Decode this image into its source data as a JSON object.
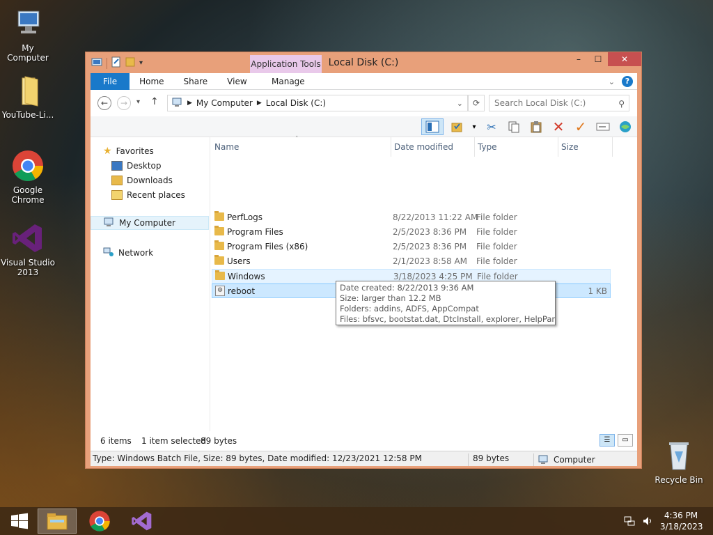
{
  "desktop": {
    "icons": [
      {
        "label": "My Computer"
      },
      {
        "label": "YouTube-Li..."
      },
      {
        "label": "Google Chrome"
      },
      {
        "label": "Visual Studio 2013"
      },
      {
        "label": "Recycle Bin"
      }
    ]
  },
  "window": {
    "title": "Local Disk (C:)",
    "context_tab": "Application Tools",
    "tabs": {
      "file": "File",
      "home": "Home",
      "share": "Share",
      "view": "View",
      "manage": "Manage"
    },
    "controls": {
      "minimize": "–",
      "maximize": "☐",
      "close": "✕"
    }
  },
  "address": {
    "crumb1": "My Computer",
    "crumb2": "Local Disk (C:)",
    "search_placeholder": "Search Local Disk (C:)"
  },
  "nav": {
    "favorites": "Favorites",
    "desktop": "Desktop",
    "downloads": "Downloads",
    "recent": "Recent places",
    "my_computer": "My Computer",
    "network": "Network"
  },
  "columns": {
    "name": "Name",
    "date": "Date modified",
    "type": "Type",
    "size": "Size"
  },
  "files": [
    {
      "name": "PerfLogs",
      "date": "8/22/2013 11:22 AM",
      "type": "File folder",
      "size": ""
    },
    {
      "name": "Program Files",
      "date": "2/5/2023 8:36 PM",
      "type": "File folder",
      "size": ""
    },
    {
      "name": "Program Files (x86)",
      "date": "2/5/2023 8:36 PM",
      "type": "File folder",
      "size": ""
    },
    {
      "name": "Users",
      "date": "2/1/2023 8:58 AM",
      "type": "File folder",
      "size": ""
    },
    {
      "name": "Windows",
      "date": "3/18/2023 4:25 PM",
      "type": "File folder",
      "size": ""
    },
    {
      "name": "reboot",
      "date": "",
      "type": "",
      "size": "1 KB"
    }
  ],
  "tooltip": {
    "line1": "Date created: 8/22/2013 9:36 AM",
    "line2": "Size: larger than 12.2 MB",
    "line3": "Folders: addins, ADFS, AppCompat",
    "line4": "Files: bfsvc, bootstat.dat, DtcInstall, explorer, HelpPane, ..."
  },
  "status": {
    "items": "6 items",
    "selected": "1 item selected",
    "bytes": "89 bytes",
    "details": "Type: Windows Batch File, Size: 89 bytes, Date modified: 12/23/2021 12:58 PM",
    "size2": "89 bytes",
    "location": "Computer"
  },
  "taskbar": {
    "time": "4:36 PM",
    "date": "3/18/2023"
  }
}
